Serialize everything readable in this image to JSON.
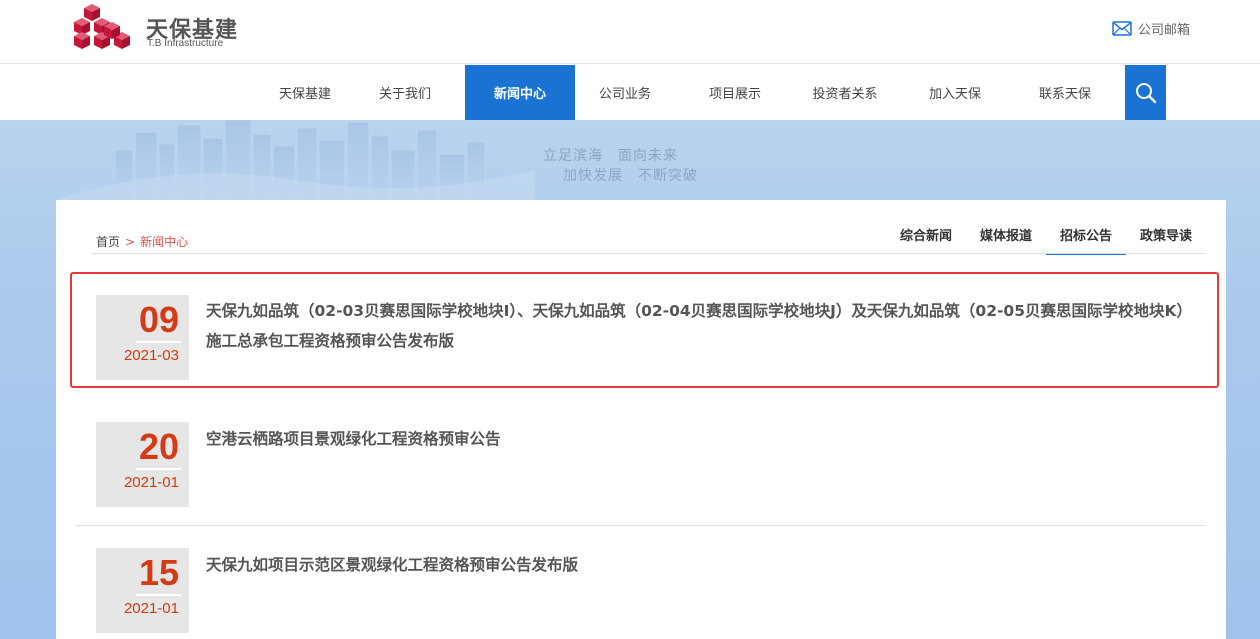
{
  "header": {
    "logo_cn": "天保基建",
    "logo_en": "T.B Infrastructure",
    "mail_label": "公司邮箱"
  },
  "nav": {
    "items": [
      {
        "label": "天保基建"
      },
      {
        "label": "关于我们"
      },
      {
        "label": "新闻中心",
        "active": true
      },
      {
        "label": "公司业务"
      },
      {
        "label": "项目展示"
      },
      {
        "label": "投资者关系"
      },
      {
        "label": "加入天保"
      },
      {
        "label": "联系天保"
      }
    ]
  },
  "banner": {
    "slogan_line1": "立足滨海　面向未来",
    "slogan_line2": "加快发展　不断突破"
  },
  "breadcrumb": {
    "home": "首页",
    "separator": ">",
    "current": "新闻中心"
  },
  "subtabs": [
    {
      "label": "综合新闻"
    },
    {
      "label": "媒体报道"
    },
    {
      "label": "招标公告",
      "active": true
    },
    {
      "label": "政策导读"
    }
  ],
  "news": [
    {
      "day": "09",
      "year_month": "2021-03",
      "title": "天保九如品筑（02-03贝赛思国际学校地块I）、天保九如品筑（02-04贝赛思国际学校地块J）及天保九如品筑（02-05贝赛思国际学校地块K）施工总承包工程资格预审公告发布版"
    },
    {
      "day": "20",
      "year_month": "2021-01",
      "title": "空港云栖路项目景观绿化工程资格预审公告"
    },
    {
      "day": "15",
      "year_month": "2021-01",
      "title": "天保九如项目示范区景观绿化工程资格预审公告发布版"
    }
  ],
  "colors": {
    "accent": "#1a73d3",
    "date_red": "#d43b14",
    "highlight_border": "#e53935",
    "logo_red": "#d3213f"
  }
}
